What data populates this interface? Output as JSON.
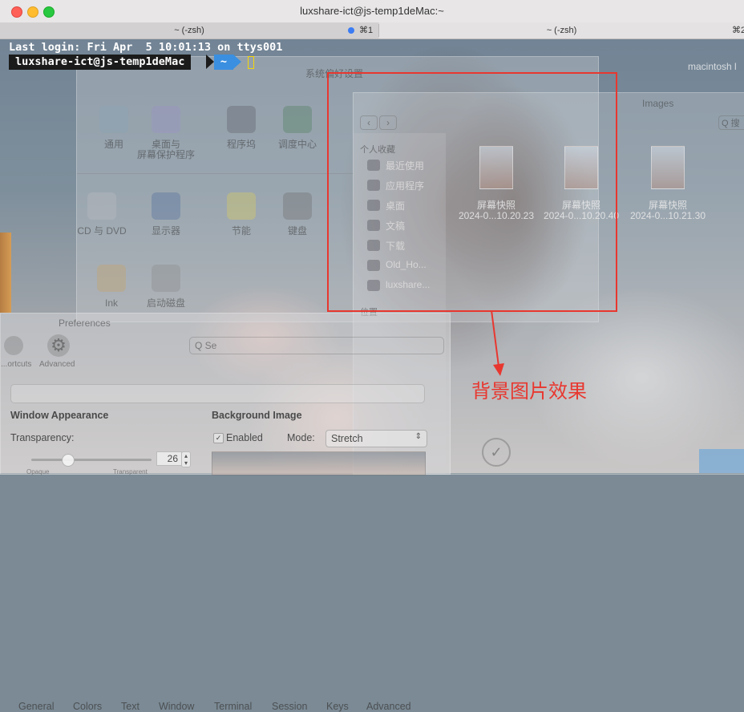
{
  "window": {
    "title": "luxshare-ict@js-temp1deMac:~"
  },
  "tabs": [
    {
      "label": "~ (-zsh)",
      "shortcut": "⌘1"
    },
    {
      "label": "~ (-zsh)",
      "shortcut": "⌘2"
    }
  ],
  "terminal": {
    "last_login": "Last login: Fri Apr  5 10:01:13 on ttys001",
    "prompt_host": "luxshare-ict@js-temp1deMac",
    "prompt_dir": "~"
  },
  "sysprefs": {
    "title": "系统偏好设置",
    "items": [
      {
        "label": "通用",
        "icon": "general-icon"
      },
      {
        "label": "桌面与\n屏幕保护程序",
        "icon": "desktop-icon"
      },
      {
        "label": "程序坞",
        "icon": "dock-icon"
      },
      {
        "label": "调度中心",
        "icon": "mission-control-icon"
      },
      {
        "label": "CD 与 DVD",
        "icon": "cd-dvd-icon"
      },
      {
        "label": "显示器",
        "icon": "display-icon"
      },
      {
        "label": "节能",
        "icon": "energy-icon"
      },
      {
        "label": "键盘",
        "icon": "keyboard-icon"
      },
      {
        "label": "Ink",
        "icon": "ink-icon"
      },
      {
        "label": "启动磁盘",
        "icon": "startup-disk-icon"
      }
    ]
  },
  "finder": {
    "title": "Images",
    "sidebar_header": "个人收藏",
    "sidebar": [
      "最近使用",
      "应用程序",
      "桌面",
      "文稿",
      "下载",
      "Old_Ho...",
      "luxshare..."
    ],
    "sidebar_footer": "位置",
    "files": [
      {
        "name": "屏幕快照",
        "date": "2024-0...10.20.23"
      },
      {
        "name": "屏幕快照",
        "date": "2024-0...10.20.40"
      },
      {
        "name": "屏幕快照",
        "date": "2024-0...10.21.30"
      }
    ],
    "search_placeholder": "Q 搜",
    "disk_label": "macintosh l"
  },
  "preferences": {
    "title": "Preferences",
    "toolbar": [
      {
        "label": "...ortcuts",
        "icon": "shortcuts-icon"
      },
      {
        "label": "Advanced",
        "icon": "gear-icon"
      }
    ],
    "search_placeholder": "Q Se",
    "tabs": [
      "General",
      "Colors",
      "Text",
      "Window",
      "Terminal",
      "Session",
      "Keys",
      "Advanced"
    ],
    "window_appearance": "Window Appearance",
    "transparency_label": "Transparency:",
    "transparency_value": "26",
    "opaque": "Opaque",
    "transparent": "Transparent",
    "background_image": "Background Image",
    "enabled_label": "Enabled",
    "mode_label": "Mode:",
    "mode_value": "Stretch"
  },
  "annotation": {
    "text": "背景图片效果",
    "color": "#e8372f"
  }
}
